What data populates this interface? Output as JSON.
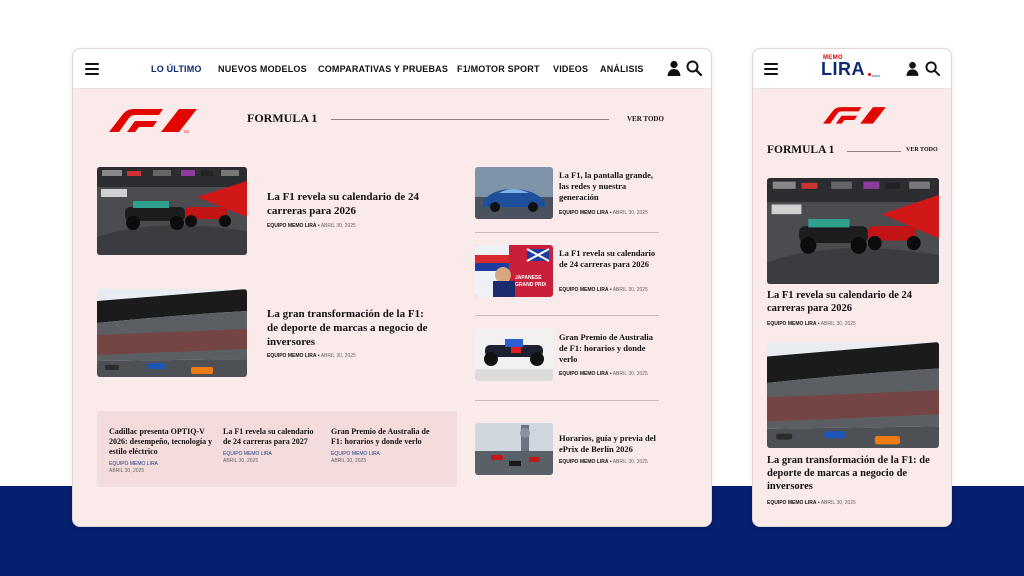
{
  "desktop": {
    "nav": [
      "LO ÚLTIMO",
      "NUEVOS MODELOS",
      "COMPARATIVAS Y PRUEBAS",
      "F1/MOTOR SPORT",
      "VIDEOS",
      "ANÁLISIS"
    ],
    "section_title": "FORMULA 1",
    "ver_todo": "VER TODO",
    "main_articles": [
      {
        "title": "La F1 revela su calendario de 24 carreras para 2026",
        "author": "EQUIPO MEMO LIRA",
        "date": "ABRIL 30, 2025"
      },
      {
        "title": "La gran transformación de la F1: de deporte de marcas a negocio de inversores",
        "author": "EQUIPO MEMO LIRA",
        "date": "ABRIL 30, 2025"
      }
    ],
    "side_articles": [
      {
        "title": "La F1, la pantalla grande, las redes y nuestra generación",
        "author": "EQUIPO MEMO LIRA",
        "date": "ABRIL 30, 2025"
      },
      {
        "title": "La F1 revela su calendario de 24 carreras para 2026",
        "author": "EQUIPO MEMO LIRA",
        "date": "ABRIL 30, 2025"
      },
      {
        "title": "Gran Premio de Australia de F1: horarios y donde verlo",
        "author": "EQUIPO MEMO LIRA",
        "date": "ABRIL 30, 2025"
      },
      {
        "title": "Horarios, guía y previa del ePrix de Berlín 2026",
        "author": "EQUIPO MEMO LIRA",
        "date": "ABRIL 30, 2025"
      }
    ],
    "bottom_articles": [
      {
        "title": "Cadillac presenta OPTIQ-V 2026: desempeño, tecnología y estilo eléctrico",
        "author": "EQUIPO MEMO LIRA",
        "date": "ABRIL 30, 2025"
      },
      {
        "title": "La F1 revela su calendario de 24 carreras para 2027",
        "author": "EQUIPO MEMO LIRA",
        "date": "ABRIL 30, 2025"
      },
      {
        "title": "Gran Premio de Australia de F1: horarios y donde verlo",
        "author": "EQUIPO MEMO LIRA",
        "date": "ABRIL 30, 2025"
      }
    ]
  },
  "mobile": {
    "logo_top": "MEMO",
    "logo_main": "LIRA",
    "logo_suffix": ".com",
    "section_title": "FORMULA 1",
    "ver_todo": "VER TODO",
    "articles": [
      {
        "title": "La F1 revela su calendario de 24 carreras para 2026",
        "author": "EQUIPO MEMO LIRA",
        "date": "ABRIL 30, 2025"
      },
      {
        "title": "La gran transformación de la F1: de deporte de marcas a negocio de inversores",
        "author": "EQUIPO MEMO LIRA",
        "date": "ABRIL 30, 2025"
      }
    ]
  },
  "image_text": {
    "poster_line1": "JAPANESE",
    "poster_line2": "GRAND PRIX"
  },
  "colors": {
    "accent": "#0d2a6e",
    "f1_red": "#e10600",
    "card_bg": "#fbeaea",
    "band": "#061f6e"
  }
}
